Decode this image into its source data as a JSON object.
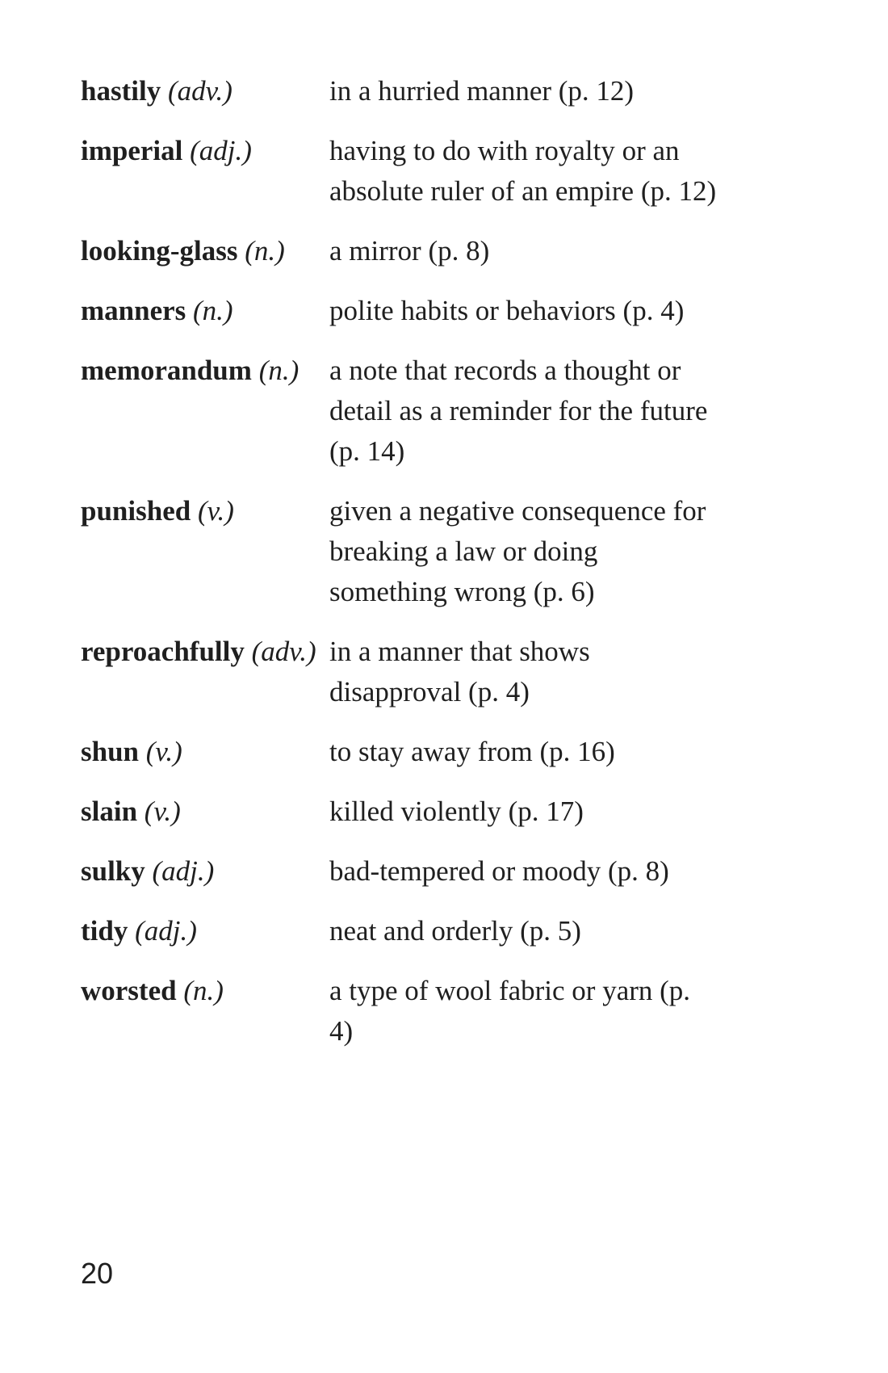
{
  "glossary": {
    "entries": [
      {
        "term": "hastily",
        "pos": "(adv.)",
        "definition": "in a hurried manner (p. 12)"
      },
      {
        "term": "imperial",
        "pos": "(adj.)",
        "definition": "having to do with royalty or an absolute ruler of an empire (p. 12)"
      },
      {
        "term": "looking-glass",
        "pos": "(n.)",
        "definition": "a mirror (p. 8)"
      },
      {
        "term": "manners",
        "pos": "(n.)",
        "definition": "polite habits or behaviors (p. 4)"
      },
      {
        "term": "memorandum",
        "pos": "(n.)",
        "definition": "a note that records a thought or detail as a reminder for the future (p. 14)"
      },
      {
        "term": "punished",
        "pos": "(v.)",
        "definition": "given a negative consequence for breaking a law or doing something wrong (p. 6)"
      },
      {
        "term": "reproachfully",
        "pos": "(adv.)",
        "definition": "in a manner that shows disapproval (p. 4)"
      },
      {
        "term": "shun",
        "pos": "(v.)",
        "definition": "to stay away from (p. 16)"
      },
      {
        "term": "slain",
        "pos": "(v.)",
        "definition": "killed violently (p. 17)"
      },
      {
        "term": "sulky",
        "pos": "(adj.)",
        "definition": "bad-tempered or moody (p. 8)"
      },
      {
        "term": "tidy",
        "pos": "(adj.)",
        "definition": "neat and orderly (p. 5)"
      },
      {
        "term": "worsted",
        "pos": "(n.)",
        "definition": "a type of wool fabric or yarn (p. 4)"
      }
    ]
  },
  "footer": {
    "page_number": "20"
  }
}
